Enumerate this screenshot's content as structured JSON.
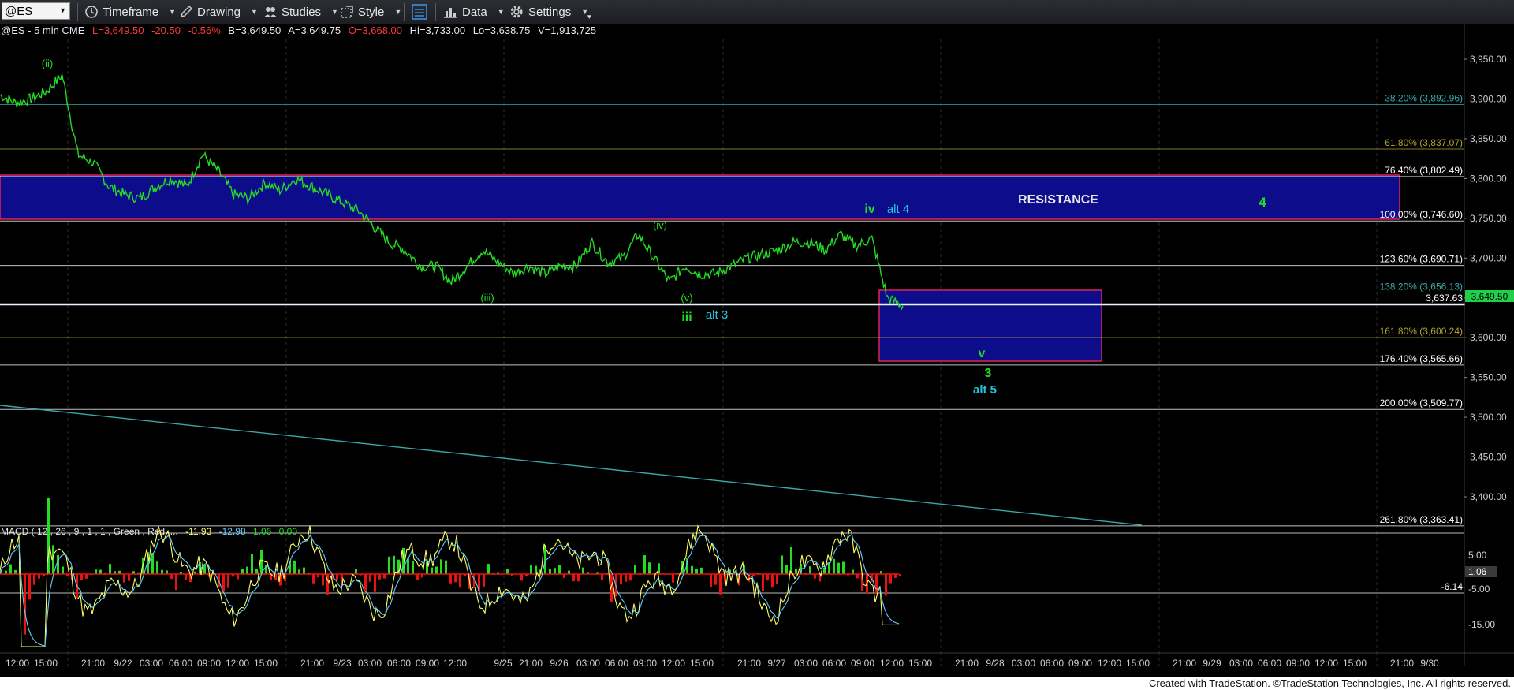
{
  "toolbar": {
    "symbol": "@ES",
    "timeframe": "Timeframe",
    "drawing": "Drawing",
    "studies": "Studies",
    "style": "Style",
    "data": "Data",
    "settings": "Settings"
  },
  "header": {
    "symbol": "@ES - 5 min CME",
    "last": "L=3,649.50",
    "change": "-20.50",
    "change_pct": "-0.56%",
    "bid": "B=3,649.50",
    "ask": "A=3,649.75",
    "open": "O=3,668.00",
    "high": "Hi=3,733.00",
    "low": "Lo=3,638.75",
    "volume": "V=1,913,725"
  },
  "price_axis": {
    "labels": [
      "3,950.00",
      "3,900.00",
      "3,850.00",
      "3,800.00",
      "3,750.00",
      "3,700.00",
      "3,650.00",
      "3,600.00",
      "3,550.00",
      "3,500.00",
      "3,450.00",
      "3,400.00"
    ],
    "last_price_tag": "3,649.50",
    "support_line_label": "3,637.63",
    "range": [
      3380,
      3970
    ]
  },
  "fib_levels": [
    {
      "label": "38.20% (3,892.96)",
      "price": 3892.96,
      "color": "#3aa8a8"
    },
    {
      "label": "61.80% (3,837.07)",
      "price": 3837.07,
      "color": "#b0a030"
    },
    {
      "label": "76.40% (3,802.49)",
      "price": 3802.49,
      "color": "#ffffff"
    },
    {
      "label": "100.00% (3,746.60)",
      "price": 3746.6,
      "color": "#ffffff"
    },
    {
      "label": "123.60% (3,690.71)",
      "price": 3690.71,
      "color": "#ffffff"
    },
    {
      "label": "138.20% (3,656.13)",
      "price": 3656.13,
      "color": "#3aa8a8"
    },
    {
      "label": "161.80% (3,600.24)",
      "price": 3600.24,
      "color": "#b0a030"
    },
    {
      "label": "176.40% (3,565.66)",
      "price": 3565.66,
      "color": "#ffffff"
    },
    {
      "label": "200.00% (3,509.77)",
      "price": 3509.77,
      "color": "#ffffff"
    },
    {
      "label": "261.80% (3,363.41)",
      "price": 3363.41,
      "color": "#ffffff"
    }
  ],
  "annotations": {
    "resistance": "RESISTANCE",
    "wave_ii": "(ii)",
    "wave_iii_paren": "(iii)",
    "wave_iv_paren": "(iv)",
    "wave_v_paren": "(v)",
    "wave_iii": "iii",
    "alt_3": "alt 3",
    "wave_iv": "iv",
    "alt_4": "alt 4",
    "wave_4": "4",
    "wave_v": "v",
    "wave_3": "3",
    "alt_5": "alt 5"
  },
  "macd": {
    "title": "MACD ( 12 , 26 , 9 , 1 , 1 , Green , Red ,...",
    "macd_value": "-11.93",
    "signal_value": "-12.98",
    "diff_value": "1.06",
    "zero_value": "0.00",
    "axis_labels": [
      "5.00",
      "-5.00",
      "-15.00"
    ],
    "diff_tag": "1.06",
    "line_label": "-6.14"
  },
  "time_axis": {
    "labels": [
      {
        "t": "12:00",
        "x": 22
      },
      {
        "t": "15:00",
        "x": 58
      },
      {
        "t": "21:00",
        "x": 118
      },
      {
        "t": "9/22",
        "x": 156
      },
      {
        "t": "03:00",
        "x": 192
      },
      {
        "t": "06:00",
        "x": 229
      },
      {
        "t": "09:00",
        "x": 265
      },
      {
        "t": "12:00",
        "x": 301
      },
      {
        "t": "15:00",
        "x": 337
      },
      {
        "t": "21:00",
        "x": 396
      },
      {
        "t": "9/23",
        "x": 434
      },
      {
        "t": "03:00",
        "x": 469
      },
      {
        "t": "06:00",
        "x": 506
      },
      {
        "t": "09:00",
        "x": 542
      },
      {
        "t": "12:00",
        "x": 577
      },
      {
        "t": "9/25",
        "x": 638
      },
      {
        "t": "21:00",
        "x": 673
      },
      {
        "t": "9/26",
        "x": 709
      },
      {
        "t": "03:00",
        "x": 746
      },
      {
        "t": "06:00",
        "x": 782
      },
      {
        "t": "09:00",
        "x": 818
      },
      {
        "t": "12:00",
        "x": 854
      },
      {
        "t": "15:00",
        "x": 890
      },
      {
        "t": "21:00",
        "x": 950
      },
      {
        "t": "9/27",
        "x": 985
      },
      {
        "t": "03:00",
        "x": 1022
      },
      {
        "t": "06:00",
        "x": 1058
      },
      {
        "t": "09:00",
        "x": 1094
      },
      {
        "t": "12:00",
        "x": 1131
      },
      {
        "t": "15:00",
        "x": 1167
      },
      {
        "t": "21:00",
        "x": 1226
      },
      {
        "t": "9/28",
        "x": 1262
      },
      {
        "t": "03:00",
        "x": 1298
      },
      {
        "t": "06:00",
        "x": 1334
      },
      {
        "t": "09:00",
        "x": 1370
      },
      {
        "t": "12:00",
        "x": 1407
      },
      {
        "t": "15:00",
        "x": 1443
      },
      {
        "t": "21:00",
        "x": 1502
      },
      {
        "t": "9/29",
        "x": 1537
      },
      {
        "t": "03:00",
        "x": 1574
      },
      {
        "t": "06:00",
        "x": 1610
      },
      {
        "t": "09:00",
        "x": 1646
      },
      {
        "t": "12:00",
        "x": 1682
      },
      {
        "t": "15:00",
        "x": 1718
      },
      {
        "t": "21:00",
        "x": 1778
      },
      {
        "t": "9/30",
        "x": 1813
      }
    ]
  },
  "footer": "Created with TradeStation. ©TradeStation Technologies, Inc. All rights reserved.",
  "colors": {
    "price_line": "#22dd22",
    "resistance_box": "#0d0d8c",
    "box_border": "#e0205a",
    "wave_green": "#22dd22",
    "wave_cyan": "#22c8e0",
    "last_price_tag": "#1fd14a"
  },
  "chart_data": {
    "type": "line",
    "xlabel": "",
    "ylabel": "",
    "ylim": [
      3380,
      3970
    ],
    "series": [
      {
        "values": [
          3905,
          3895,
          3900,
          3910,
          3930,
          3830,
          3820,
          3790,
          3780,
          3775,
          3790,
          3800,
          3790,
          3830,
          3810,
          3780,
          3775,
          3795,
          3785,
          3800,
          3790,
          3780,
          3770,
          3760,
          3740,
          3720,
          3710,
          3690,
          3690,
          3670,
          3690,
          3710,
          3695,
          3680,
          3690,
          3680,
          3690,
          3690,
          3720,
          3695,
          3700,
          3730,
          3700,
          3670,
          3690,
          3680,
          3680,
          3690,
          3700,
          3705,
          3710,
          3720,
          3720,
          3710,
          3730,
          3715,
          3725,
          3650,
          3640
        ]
      }
    ]
  }
}
